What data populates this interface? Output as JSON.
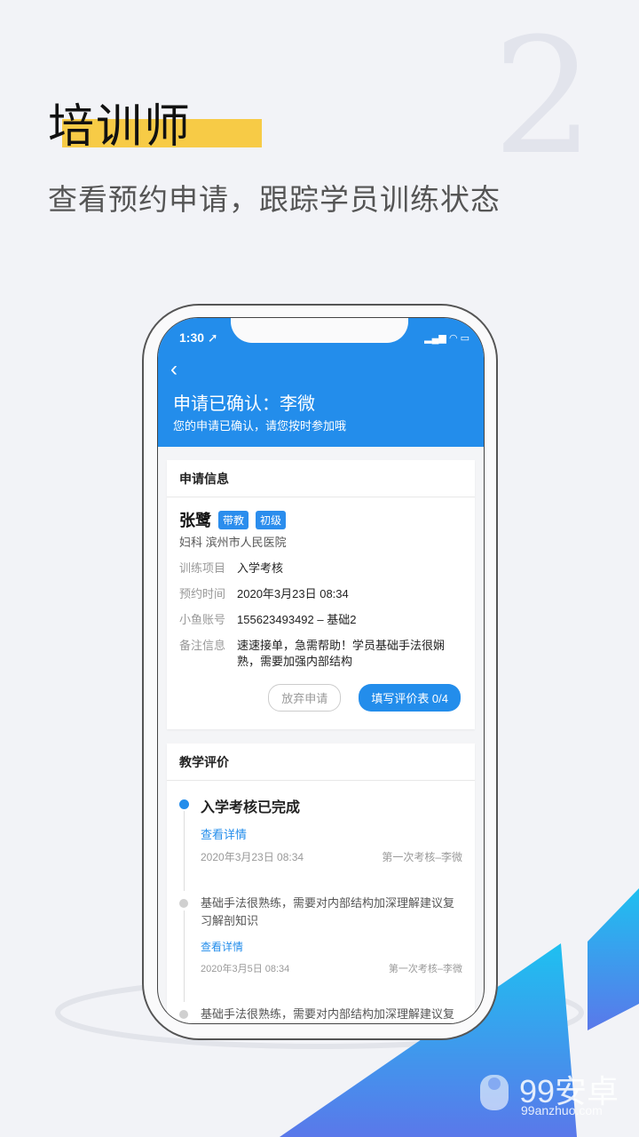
{
  "promo": {
    "number": "2",
    "title": "培训师",
    "subtitle": "查看预约申请，跟踪学员训练状态"
  },
  "status": {
    "time": "1:30 ➚",
    "icons": "▂▄▆ ◠ ▭"
  },
  "header": {
    "back": "‹",
    "title": "申请已确认：李微",
    "subtitle": "您的申请已确认，请您按时参加哦"
  },
  "apply": {
    "section": "申请信息",
    "name": "张鹭",
    "tags": [
      "带教",
      "初级"
    ],
    "dept": "妇科  滨州市人民医院",
    "rows": [
      {
        "k": "训练项目",
        "v": "入学考核"
      },
      {
        "k": "预约时间",
        "v": "2020年3月23日 08:34"
      },
      {
        "k": "小鱼账号",
        "v": "155623493492 – 基础2"
      },
      {
        "k": "备注信息",
        "v": "速速接单，急需帮助！学员基础手法很娴熟，需要加强内部结构"
      }
    ],
    "abandon": "放弃申请",
    "fill": "填写评价表 0/4"
  },
  "eval": {
    "section": "教学评价",
    "items": [
      {
        "title": "入学考核已完成",
        "link": "查看详情",
        "date": "2020年3月23日 08:34",
        "by": "第一次考核–李微"
      },
      {
        "text": "基础手法很熟练，需要对内部结构加深理解建议复习解剖知识",
        "link": "查看详情",
        "date": "2020年3月5日 08:34",
        "by": "第一次考核–李微"
      },
      {
        "text": "基础手法很熟练，需要对内部结构加深理解建议复习解剖知识"
      }
    ]
  },
  "watermark": {
    "name": "99安卓",
    "url": "99anzhuo.com"
  },
  "colors": {
    "primary": "#238deb",
    "highlight": "#f7cb46"
  }
}
